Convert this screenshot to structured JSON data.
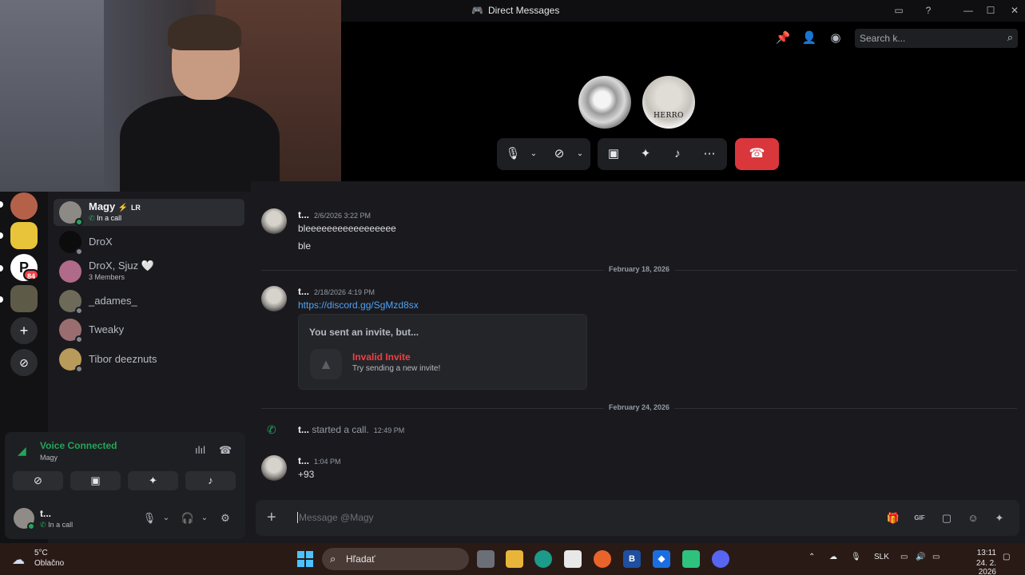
{
  "window": {
    "title": "Direct Messages"
  },
  "search": {
    "placeholder": "Search k..."
  },
  "call": {
    "avatar2_text": "HERRO"
  },
  "server_rail": {
    "badge": "84"
  },
  "dm_list": [
    {
      "name": "Magy",
      "tag": "LR",
      "sub": "In a call",
      "active": true
    },
    {
      "name": "DroX"
    },
    {
      "name": "DroX, Sjuz",
      "sub": "3 Members"
    },
    {
      "name": "_adames_"
    },
    {
      "name": "Tweaky"
    },
    {
      "name": "Tibor deeznuts"
    }
  ],
  "voice": {
    "title": "Voice Connected",
    "channel": "Magy"
  },
  "user": {
    "name": "t...",
    "status": "In a call"
  },
  "messages": [
    {
      "author": "t...",
      "time": "2/6/2026 3:22 PM",
      "lines": [
        "bleeeeeeeeeeeeeeeee",
        "ble"
      ]
    },
    {
      "divider": "February 18, 2026"
    },
    {
      "author": "t...",
      "time": "2/18/2026 4:19 PM",
      "link": "https://discord.gg/SgMzd8sx",
      "invite": {
        "header": "You sent an invite, but...",
        "title": "Invalid Invite",
        "subtitle": "Try sending a new invite!"
      }
    },
    {
      "divider": "February 24, 2026"
    },
    {
      "system": {
        "author": "t...",
        "text": "started a call.",
        "time": "12:49 PM"
      }
    },
    {
      "author": "t...",
      "time": "1:04 PM",
      "lines": [
        "+93"
      ]
    }
  ],
  "composer": {
    "placeholder": "Message @Magy"
  },
  "taskbar": {
    "weather_temp": "5°C",
    "weather_desc": "Oblačno",
    "search_label": "Hľadať",
    "lang": "SLK",
    "time": "13:11",
    "date": "24. 2. 2026"
  }
}
